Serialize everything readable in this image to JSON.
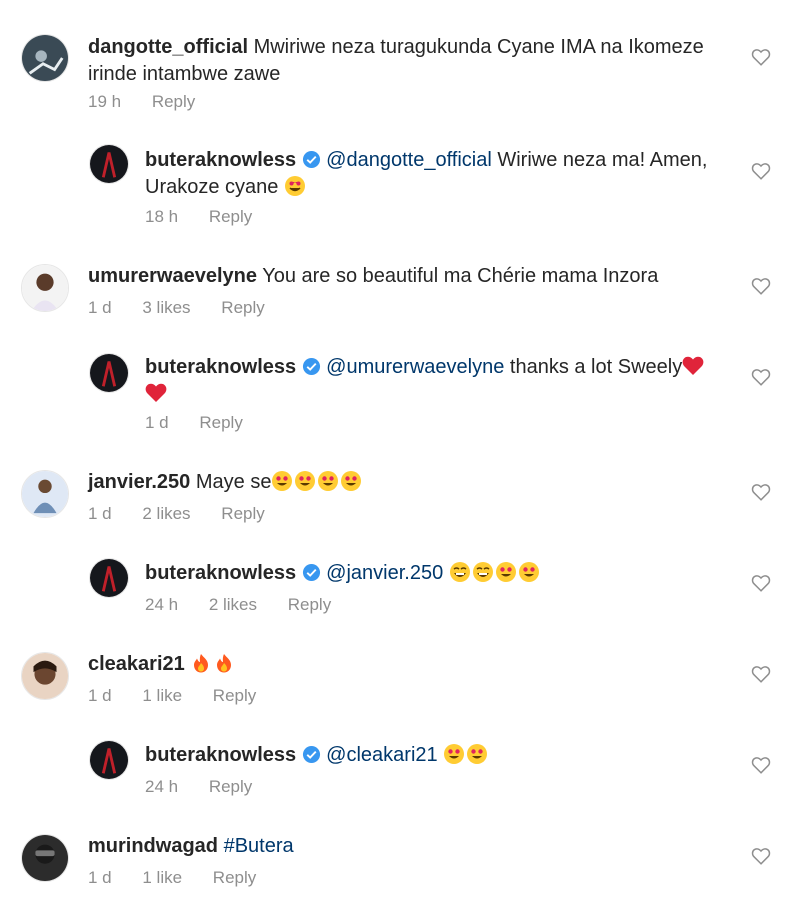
{
  "comments": [
    {
      "username": "dangotte_official",
      "text": "Mwiriwe neza turagukunda Cyane IMA na Ikomeze irinde intambwe zawe",
      "time": "19 h",
      "likes": "",
      "reply_label": "Reply",
      "reply": {
        "username": "buteraknowless",
        "mention": "@dangotte_official",
        "text": "Wiriwe neza ma! Amen, Urakoze cyane",
        "emojis": [
          "heart-eyes-face"
        ],
        "time": "18 h",
        "likes": "",
        "reply_label": "Reply"
      }
    },
    {
      "username": "umurerwaevelyne",
      "text": "You are so beautiful ma Chérie mama Inzora",
      "time": "1 d",
      "likes": "3 likes",
      "reply_label": "Reply",
      "reply": {
        "username": "buteraknowless",
        "mention": "@umurerwaevelyne",
        "text": "thanks a lot Sweely",
        "emojis": [
          "red-heart",
          "red-heart"
        ],
        "time": "1 d",
        "likes": "",
        "reply_label": "Reply"
      }
    },
    {
      "username": "janvier.250",
      "text": "Maye se",
      "emojis": [
        "heart-eyes-face",
        "heart-eyes-face",
        "heart-eyes-face",
        "heart-eyes-face"
      ],
      "time": "1 d",
      "likes": "2 likes",
      "reply_label": "Reply",
      "reply": {
        "username": "buteraknowless",
        "mention": "@janvier.250",
        "text": "",
        "emojis": [
          "grinning-face",
          "grinning-face",
          "heart-eyes-face",
          "heart-eyes-face"
        ],
        "time": "24 h",
        "likes": "2 likes",
        "reply_label": "Reply"
      }
    },
    {
      "username": "cleakari21",
      "text": "",
      "emojis": [
        "fire",
        "fire"
      ],
      "time": "1 d",
      "likes": "1 like",
      "reply_label": "Reply",
      "reply": {
        "username": "buteraknowless",
        "mention": "@cleakari21",
        "text": "",
        "emojis": [
          "heart-eyes-face",
          "heart-eyes-face"
        ],
        "time": "24 h",
        "likes": "",
        "reply_label": "Reply"
      }
    },
    {
      "username": "murindwagad",
      "hashtag": "#Butera",
      "text": "",
      "time": "1 d",
      "likes": "1 like",
      "reply_label": "Reply"
    }
  ],
  "colors": {
    "text": "#262626",
    "meta": "#8e8e8e",
    "mention": "#00376b",
    "verified": "#3897f0"
  }
}
